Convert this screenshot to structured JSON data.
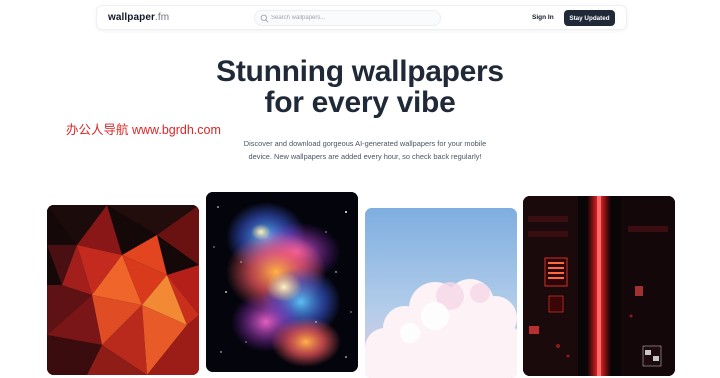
{
  "header": {
    "logo_main": "wallpaper",
    "logo_suffix": ".fm",
    "search_placeholder": "Search wallpapers...",
    "signin_label": "Sign In",
    "cta_label": "Stay Updated"
  },
  "hero": {
    "title_line1": "Stunning wallpapers",
    "title_line2": "for every vibe",
    "description_line1": "Discover and download gorgeous AI-generated wallpapers for your mobile",
    "description_line2": "device. New wallpapers are added every hour, so check back regularly!"
  },
  "watermark": "办公人导航 www.bgrdh.com",
  "wallpapers": [
    {
      "theme": "red-low-poly-geometric"
    },
    {
      "theme": "colorful-nebula-space"
    },
    {
      "theme": "pastel-clouds-sky"
    },
    {
      "theme": "neon-city-street"
    }
  ],
  "colors": {
    "cta_bg": "#1f2937",
    "title": "#1f2937",
    "watermark": "#dc2626",
    "body_text": "#4b5563"
  }
}
